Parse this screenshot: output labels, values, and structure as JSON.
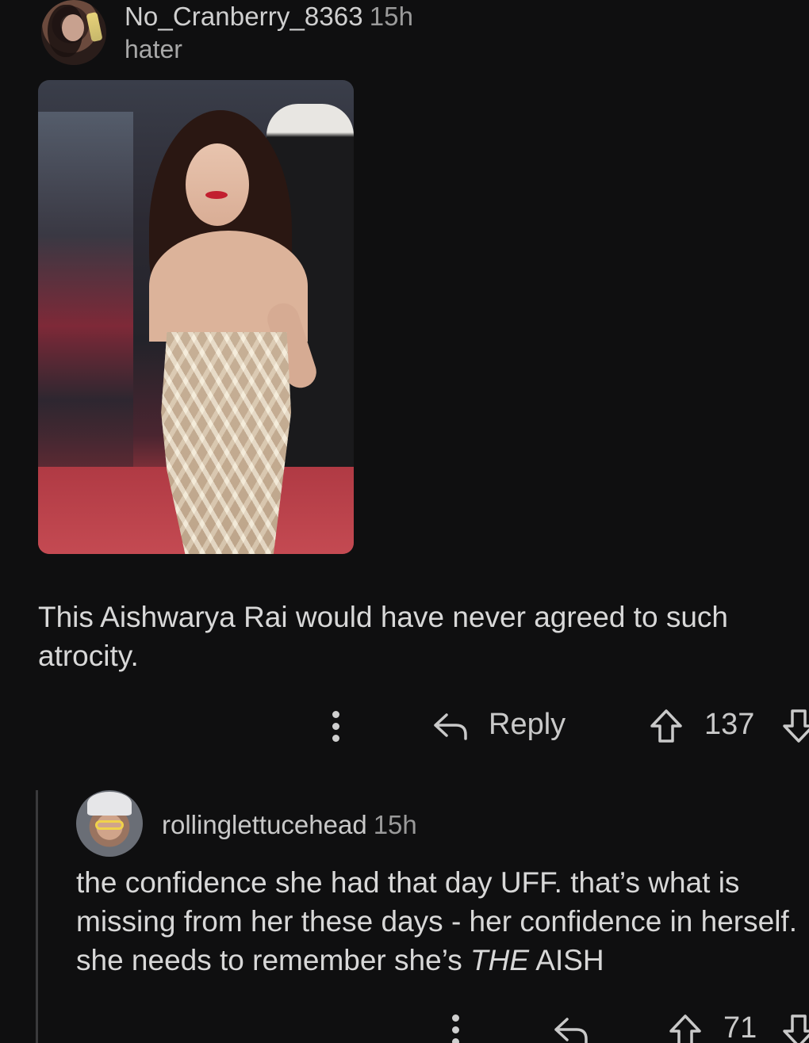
{
  "comment": {
    "username": "No_Cranberry_8363",
    "time": "15h",
    "flair": "hater",
    "body": "This Aishwarya Rai would have never agreed to such atrocity.",
    "actions": {
      "reply_label": "Reply",
      "score": "137"
    }
  },
  "reply": {
    "username": "rollinglettucehead",
    "time": "15h",
    "body_part1": "the confidence she had that day UFF. that’s what is missing from her these days - her confidence in herself. she needs to remember she’s ",
    "body_emphasis": "THE",
    "body_part2": " AISH",
    "actions": {
      "score": "71"
    }
  },
  "icons": {
    "more": "more-vertical-icon",
    "reply": "reply-arrow-icon",
    "upvote": "upvote-arrow-icon",
    "downvote": "downvote-arrow-icon"
  },
  "colors": {
    "background": "#0f0f10",
    "text": "#d8d8d8",
    "muted": "#9a9a9a",
    "thread_line": "#3a3a3c"
  }
}
